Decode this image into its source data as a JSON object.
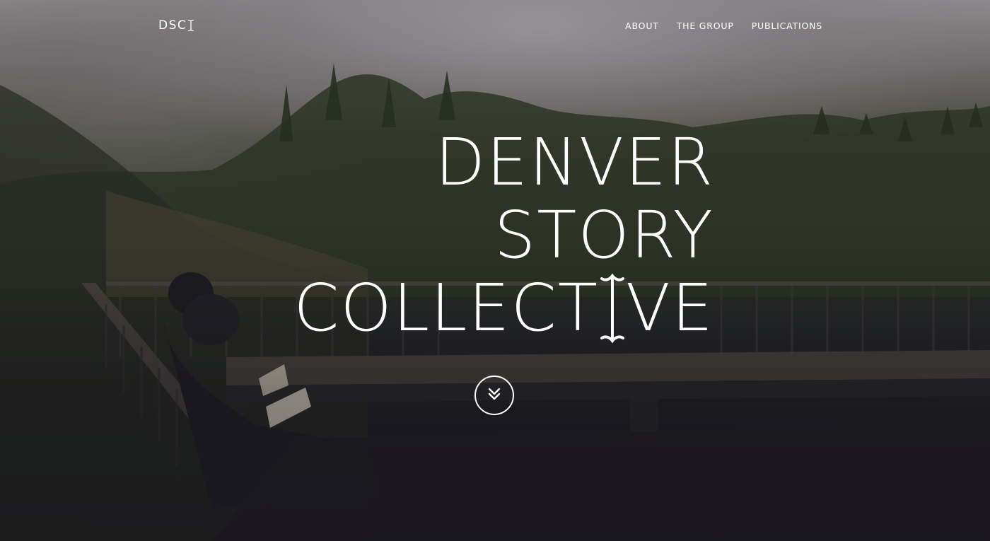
{
  "header": {
    "logo_text": "DSC"
  },
  "nav": {
    "items": [
      {
        "label": "ABOUT"
      },
      {
        "label": "THE GROUP"
      },
      {
        "label": "PUBLICATIONS"
      }
    ]
  },
  "hero": {
    "title_line1": "DENVER",
    "title_line2": "STORY",
    "title_line3_prefix": "COLLECT",
    "title_line3_suffix": "VE"
  },
  "icons": {
    "logo_mark": "serif-i-icon",
    "title_mark": "serif-i-icon",
    "scroll": "double-chevron-down-icon"
  },
  "colors": {
    "text": "#ffffff",
    "accent": "#ffffff"
  }
}
